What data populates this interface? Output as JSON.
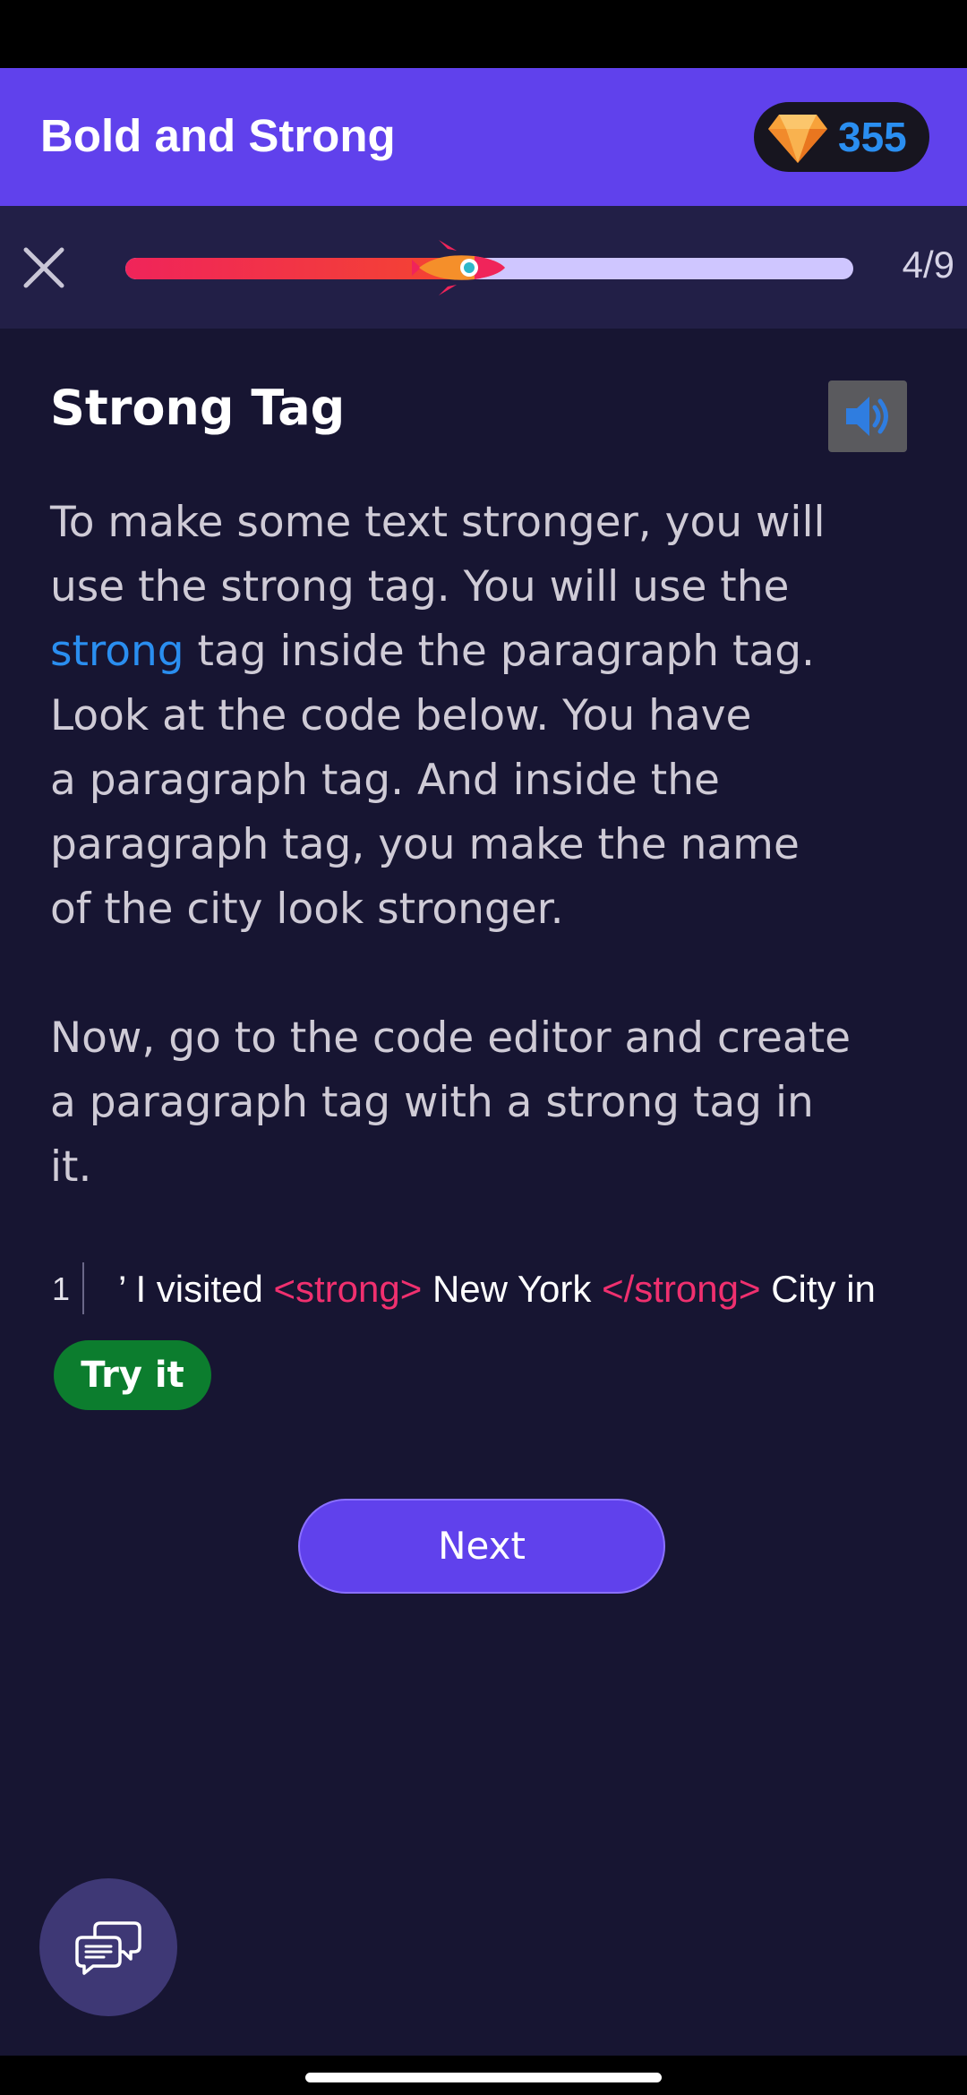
{
  "header": {
    "title": "Bold and Strong",
    "gems": "355"
  },
  "progress": {
    "counter": "4/9",
    "fraction": 0.48
  },
  "lesson": {
    "title": "Strong Tag",
    "body_lines": [
      [
        "To make some text stronger, you will"
      ],
      [
        "use the strong tag. You will use the"
      ],
      [
        {
          "kw": "strong"
        },
        " tag inside the paragraph tag."
      ],
      [
        "Look at the code below. You have"
      ],
      [
        "a paragraph tag. And inside the"
      ],
      [
        "paragraph tag, you make the name"
      ],
      [
        "of the city look stronger."
      ],
      [],
      [
        "Now, go to the code editor and create"
      ],
      [
        "a paragraph tag with a strong tag in"
      ],
      [
        "it."
      ]
    ]
  },
  "code": {
    "line_number": "1",
    "segments": [
      {
        "text": "’ I visited ",
        "kind": "text"
      },
      {
        "text": "<strong>",
        "kind": "tag"
      },
      {
        "text": " New York ",
        "kind": "text"
      },
      {
        "text": "</strong>",
        "kind": "tag"
      },
      {
        "text": " City in",
        "kind": "text"
      }
    ]
  },
  "buttons": {
    "try_it": "Try it",
    "next": "Next"
  },
  "icons": {
    "close": "close-icon",
    "gem": "diamond-icon",
    "rocket": "rocket-icon",
    "audio": "speaker-icon",
    "chat": "chat-bubbles-icon"
  },
  "colors": {
    "app_bar": "#6041ec",
    "background": "#171532",
    "keyword": "#2a8ef0",
    "tag": "#f0306f",
    "try_button": "#0c7d2e",
    "progress_fill": "#f0245a",
    "progress_track": "#cfc6ff"
  }
}
